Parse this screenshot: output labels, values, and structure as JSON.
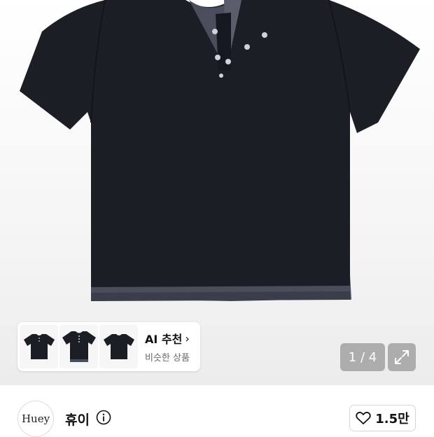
{
  "gallery": {
    "current_page": "1",
    "total_pages": "4",
    "pager_text": "1 / 4"
  },
  "ai_recommend": {
    "title": "AI 추천",
    "subtitle": "비슷한 상품",
    "thumbnail_count": 3
  },
  "seller": {
    "avatar_text": "Huey",
    "name": "휴이"
  },
  "like": {
    "count": "1.5만"
  },
  "colors": {
    "shirt": "#1b1e25",
    "shirt_layer": "#4a4d5c",
    "pager_bg": "#787878"
  },
  "icons": {
    "chevron": "chevron-right-icon",
    "expand": "expand-icon",
    "info": "info-icon",
    "heart": "heart-outline-icon"
  }
}
